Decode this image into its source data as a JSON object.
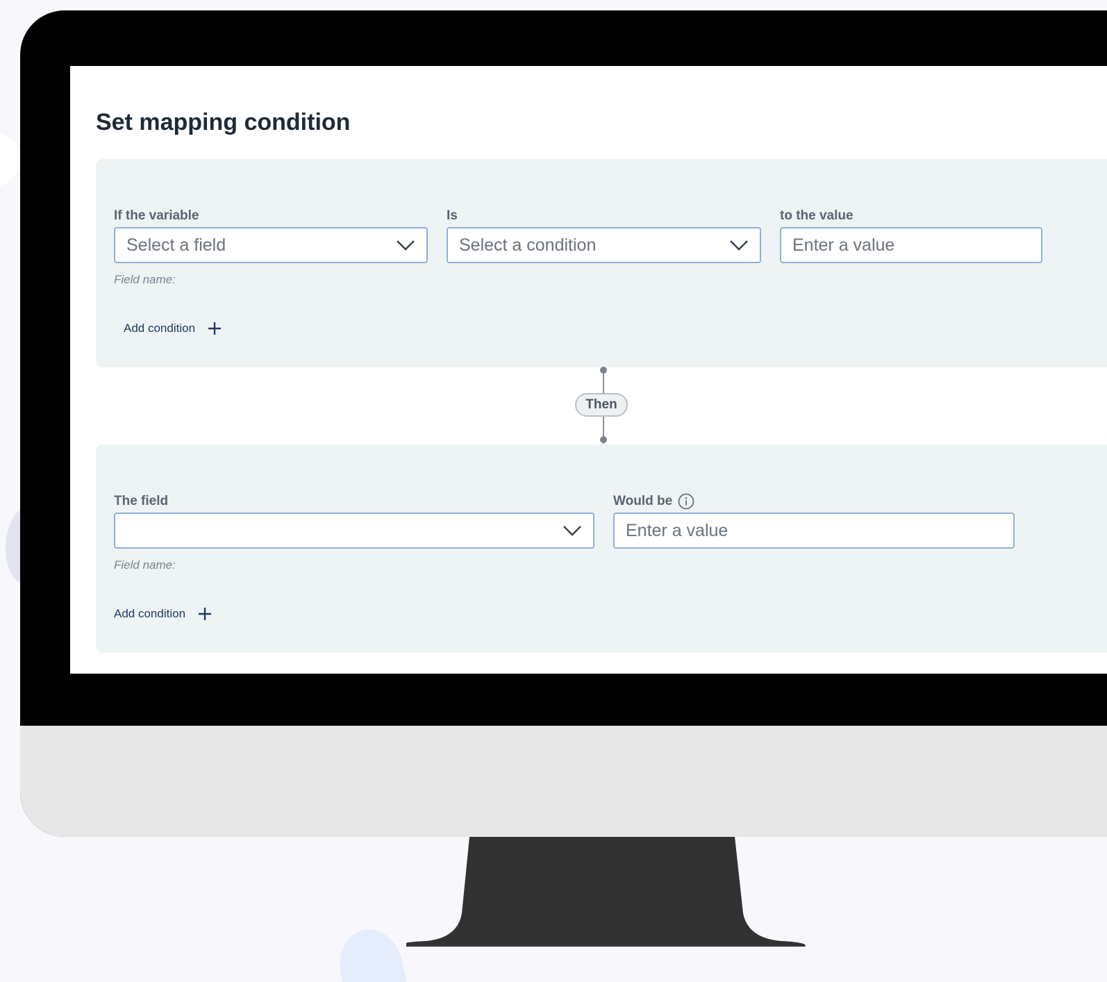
{
  "dialog": {
    "title": "Set mapping condition"
  },
  "condition": {
    "variable_label": "If the variable",
    "variable_placeholder": "Select a field",
    "operator_label": "Is",
    "operator_placeholder": "Select a condition",
    "value_label": "to the value",
    "value_placeholder": "Enter a value",
    "field_name_hint": "Field name:",
    "add_condition_label": "Add condition"
  },
  "connector": {
    "label": "Then"
  },
  "result": {
    "field_label": "The field",
    "field_value": "",
    "would_be_label": "Would be",
    "would_be_placeholder": "Enter a value",
    "field_name_hint": "Field name:",
    "add_condition_label": "Add condition"
  },
  "icons": {
    "dropdown": "chevron-down-icon",
    "add": "plus-icon",
    "info": "info-icon"
  },
  "colors": {
    "panel_background": "#eef3f3",
    "input_border": "#8fb0de",
    "link_text": "#1f3a66",
    "monitor_frame": "#000000",
    "monitor_chin": "#e7e7e7",
    "monitor_stand": "#323232"
  }
}
